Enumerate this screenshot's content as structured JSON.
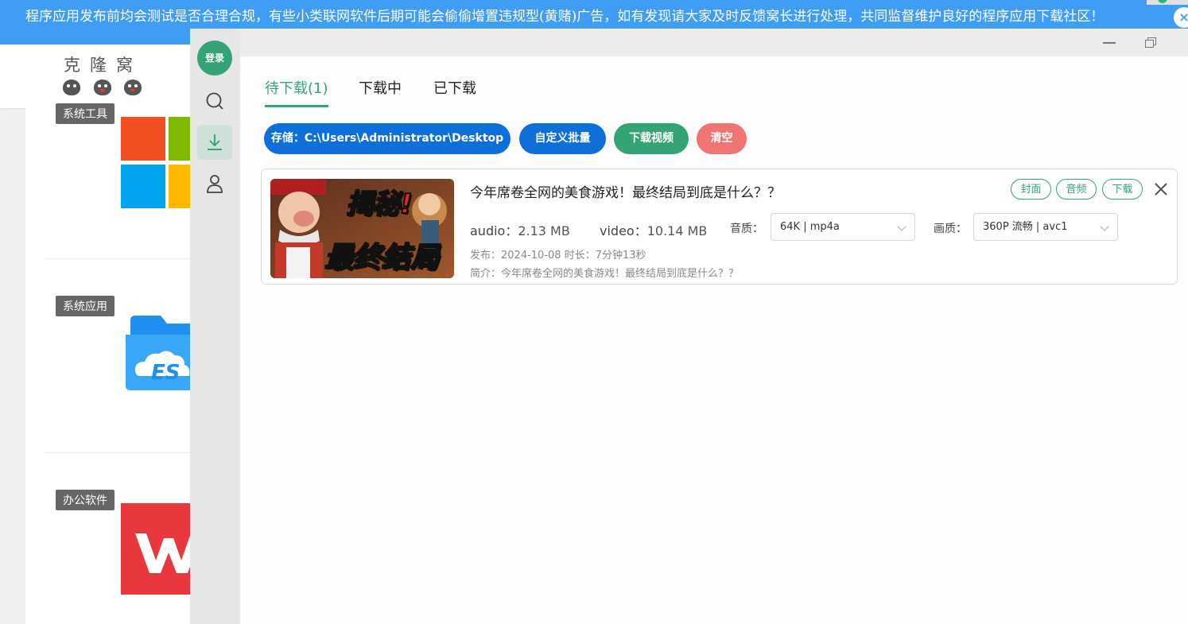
{
  "notice": {
    "text": "程序应用发布前均会测试是否合理合规，有些小类联网软件后期可能会偷偷增置违规型(黄赌)广告，如有发现请大家及时反馈窝长进行处理，共同监督维护良好的程序应用下载社区！",
    "close_icon": "×"
  },
  "site": {
    "logo_text": "克隆窝",
    "categories": [
      "系统工具",
      "系统应用",
      "办公软件"
    ]
  },
  "app": {
    "login_label": "登录",
    "nav_icons": [
      "search-icon",
      "download-icon",
      "user-icon"
    ],
    "accent_color": "#34a476",
    "tabs": [
      "待下载(1)",
      "下载中",
      "已下载"
    ],
    "buttons": {
      "storage": "存储：C:\\Users\\Administrator\\Desktop",
      "custom_batch": "自定义批量",
      "download_video": "下载视频",
      "clear": "清空"
    },
    "video": {
      "title": "今年席卷全网的美食游戏！最终结局到底是什么？？",
      "thumb_text_top": "揭秘!",
      "thumb_text_bottom": "最终结局",
      "action_cover": "封面",
      "action_audio": "音频",
      "action_download": "下载",
      "audio_label": "audio：",
      "audio_size": "2.13 MB",
      "video_label": "video：",
      "video_size": "10.14 MB",
      "audio_quality_label": "音质：",
      "audio_quality_value": "64K | mp4a",
      "video_quality_label": "画质：",
      "video_quality_value": "360P 流畅 | avc1",
      "publish_line": "发布：2024-10-08 时长：7分钟13秒",
      "intro_line": "简介：今年席卷全网的美食游戏！最终结局到底是什么？？"
    }
  }
}
